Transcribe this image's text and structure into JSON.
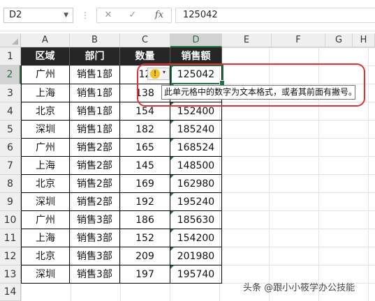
{
  "formula_bar": {
    "name_box": "D2",
    "cancel_glyph": "✕",
    "enter_glyph": "✓",
    "fx_glyph": "fx",
    "formula_value": "125042"
  },
  "columns": [
    "A",
    "B",
    "C",
    "D",
    "E",
    "F",
    "G",
    "H"
  ],
  "rows": [
    "1",
    "2",
    "3",
    "4",
    "5",
    "6",
    "7",
    "8",
    "9",
    "10",
    "11",
    "12",
    "13",
    "14"
  ],
  "table": {
    "headers": [
      "区域",
      "部门",
      "数量",
      "销售额"
    ],
    "rows": [
      {
        "region": "广州",
        "dept": "销售1部",
        "qty": "12",
        "sales": "125042"
      },
      {
        "region": "上海",
        "dept": "销售1部",
        "qty": "138",
        "sales": "136"
      },
      {
        "region": "北京",
        "dept": "销售1部",
        "qty": "154",
        "sales": "152400"
      },
      {
        "region": "深圳",
        "dept": "销售1部",
        "qty": "182",
        "sales": "185240"
      },
      {
        "region": "广州",
        "dept": "销售2部",
        "qty": "165",
        "sales": "168524"
      },
      {
        "region": "上海",
        "dept": "销售2部",
        "qty": "145",
        "sales": "148500"
      },
      {
        "region": "北京",
        "dept": "销售2部",
        "qty": "169",
        "sales": "162980"
      },
      {
        "region": "深圳",
        "dept": "销售2部",
        "qty": "192",
        "sales": "195240"
      },
      {
        "region": "广州",
        "dept": "销售3部",
        "qty": "186",
        "sales": "185630"
      },
      {
        "region": "上海",
        "dept": "销售3部",
        "qty": "152",
        "sales": "154200"
      },
      {
        "region": "北京",
        "dept": "销售3部",
        "qty": "209",
        "sales": "201980"
      },
      {
        "region": "深圳",
        "dept": "销售3部",
        "qty": "197",
        "sales": "195740"
      }
    ]
  },
  "error_tooltip": "此单元格中的数字为文本格式，或者其前面有撇号。",
  "error_icon_glyph": "!",
  "error_dropdown_glyph": "▾",
  "watermark": "头条 @跟小小筱学办公技能",
  "colors": {
    "header_fill": "#262626",
    "header_text": "#ffffff",
    "selection": "#217346",
    "text_number_flag": "#1e7145",
    "highlight_ring": "#e2302f",
    "warning_icon": "#f0c325"
  }
}
